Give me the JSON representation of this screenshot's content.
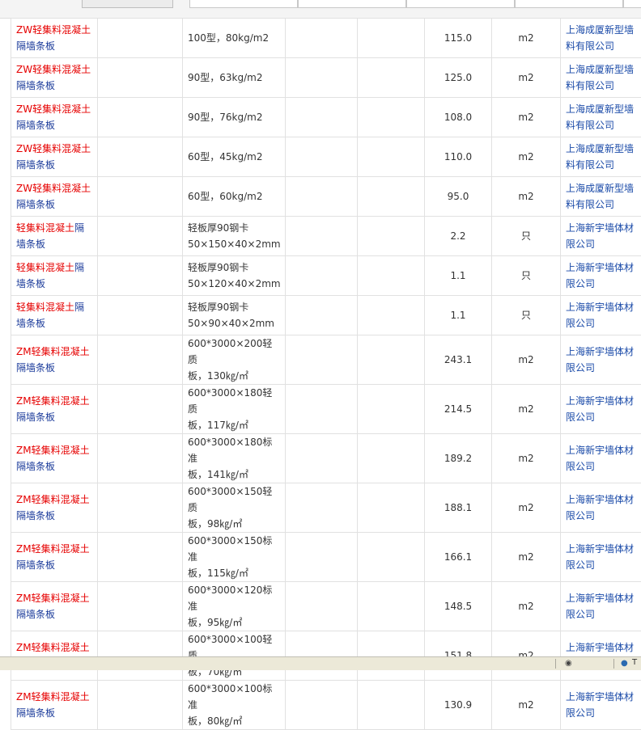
{
  "rows": [
    {
      "name_red": "ZW轻集料混凝土",
      "name_blue": "隔墙条板",
      "spec_line1": "100型，80kg/m2",
      "spec_line2": "",
      "price": "115.0",
      "unit": "m2",
      "company_line1": "上海成厦新型墙",
      "company_line2": "料有限公司"
    },
    {
      "name_red": "ZW轻集料混凝土",
      "name_blue": "隔墙条板",
      "spec_line1": "90型，63kg/m2",
      "spec_line2": "",
      "price": "125.0",
      "unit": "m2",
      "company_line1": "上海成厦新型墙",
      "company_line2": "料有限公司"
    },
    {
      "name_red": "ZW轻集料混凝土",
      "name_blue": "隔墙条板",
      "spec_line1": "90型，76kg/m2",
      "spec_line2": "",
      "price": "108.0",
      "unit": "m2",
      "company_line1": "上海成厦新型墙",
      "company_line2": "料有限公司"
    },
    {
      "name_red": "ZW轻集料混凝土",
      "name_blue": "隔墙条板",
      "spec_line1": "60型，45kg/m2",
      "spec_line2": "",
      "price": "110.0",
      "unit": "m2",
      "company_line1": "上海成厦新型墙",
      "company_line2": "料有限公司"
    },
    {
      "name_red": "ZW轻集料混凝土",
      "name_blue": "隔墙条板",
      "spec_line1": "60型，60kg/m2",
      "spec_line2": "",
      "price": "95.0",
      "unit": "m2",
      "company_line1": "上海成厦新型墙",
      "company_line2": "料有限公司"
    },
    {
      "name_red": "轻集料混凝土",
      "name_blue": "隔墙条板",
      "spec_line1": "轻板厚90钢卡",
      "spec_line2": "50×150×40×2mm",
      "price": "2.2",
      "unit": "只",
      "company_line1": "上海新宇墙体材",
      "company_line2": "限公司"
    },
    {
      "name_red": "轻集料混凝土",
      "name_blue": "隔墙条板",
      "spec_line1": "轻板厚90钢卡",
      "spec_line2": "50×120×40×2mm",
      "price": "1.1",
      "unit": "只",
      "company_line1": "上海新宇墙体材",
      "company_line2": "限公司"
    },
    {
      "name_red": "轻集料混凝土",
      "name_blue": "隔墙条板",
      "spec_line1": "轻板厚90钢卡",
      "spec_line2": "50×90×40×2mm",
      "price": "1.1",
      "unit": "只",
      "company_line1": "上海新宇墙体材",
      "company_line2": "限公司"
    },
    {
      "name_red": "ZM轻集料混凝土",
      "name_blue": "隔墙条板",
      "spec_line1": "600*3000×200轻质",
      "spec_line2": "板，130㎏/㎡",
      "price": "243.1",
      "unit": "m2",
      "company_line1": "上海新宇墙体材",
      "company_line2": "限公司"
    },
    {
      "name_red": "ZM轻集料混凝土",
      "name_blue": "隔墙条板",
      "spec_line1": "600*3000×180轻质",
      "spec_line2": "板，117㎏/㎡",
      "price": "214.5",
      "unit": "m2",
      "company_line1": "上海新宇墙体材",
      "company_line2": "限公司"
    },
    {
      "name_red": "ZM轻集料混凝土",
      "name_blue": "隔墙条板",
      "spec_line1": "600*3000×180标准",
      "spec_line2": "板，141㎏/㎡",
      "price": "189.2",
      "unit": "m2",
      "company_line1": "上海新宇墙体材",
      "company_line2": "限公司"
    },
    {
      "name_red": "ZM轻集料混凝土",
      "name_blue": "隔墙条板",
      "spec_line1": "600*3000×150轻质",
      "spec_line2": "板，98㎏/㎡",
      "price": "188.1",
      "unit": "m2",
      "company_line1": "上海新宇墙体材",
      "company_line2": "限公司"
    },
    {
      "name_red": "ZM轻集料混凝土",
      "name_blue": "隔墙条板",
      "spec_line1": "600*3000×150标准",
      "spec_line2": "板，115㎏/㎡",
      "price": "166.1",
      "unit": "m2",
      "company_line1": "上海新宇墙体材",
      "company_line2": "限公司"
    },
    {
      "name_red": "ZM轻集料混凝土",
      "name_blue": "隔墙条板",
      "spec_line1": "600*3000×120标准",
      "spec_line2": "板，95㎏/㎡",
      "price": "148.5",
      "unit": "m2",
      "company_line1": "上海新宇墙体材",
      "company_line2": "限公司"
    },
    {
      "name_red": "ZM轻集料混凝土",
      "name_blue": "隔墙条板",
      "spec_line1": "600*3000×100轻质",
      "spec_line2": "板，70㎏/㎡",
      "price": "151.8",
      "unit": "m2",
      "company_line1": "上海新宇墙体材",
      "company_line2": "限公司"
    },
    {
      "name_red": "ZM轻集料混凝土",
      "name_blue": "隔墙条板",
      "spec_line1": "600*3000×100标准",
      "spec_line2": "板，80㎏/㎡",
      "price": "130.9",
      "unit": "m2",
      "company_line1": "上海新宇墙体材",
      "company_line2": "限公司"
    }
  ],
  "statusbar": {
    "text": "T"
  },
  "colors": {
    "name_highlight": "#e60000",
    "name_link": "#1a3a9a",
    "company_link": "#1a4aa8"
  }
}
